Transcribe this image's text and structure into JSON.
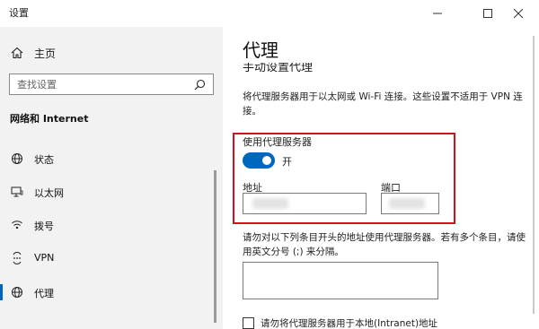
{
  "window": {
    "title": "设置",
    "minimize_icon": "minimize-icon",
    "maximize_icon": "maximize-icon",
    "close_icon": "close-icon"
  },
  "sidebar": {
    "home_label": "主页",
    "home_icon": "home-icon",
    "search_placeholder": "查找设置",
    "search_icon": "search-icon",
    "section_title": "网络和 Internet",
    "items": [
      {
        "label": "状态",
        "icon": "globe-icon",
        "active": false
      },
      {
        "label": "以太网",
        "icon": "monitor-icon",
        "active": false
      },
      {
        "label": "拨号",
        "icon": "dialup-icon",
        "active": false
      },
      {
        "label": "VPN",
        "icon": "vpn-icon",
        "active": false
      },
      {
        "label": "代理",
        "icon": "globe-proxy-icon",
        "active": true
      }
    ]
  },
  "main": {
    "page_title": "代理",
    "partial_heading": "手动设置代理",
    "description": "将代理服务器用于以太网或 Wi-Fi 连接。这些设置不适用于 VPN 连接。",
    "use_proxy_label": "使用代理服务器",
    "toggle_on": true,
    "toggle_state_label": "开",
    "address_label": "地址",
    "address_value": "",
    "port_label": "端口",
    "port_value": "",
    "exceptions_description": "请勿对以下列条目开头的地址使用代理服务器。若有多个条目，请使用英文分号 (;) 来分隔。",
    "exceptions_value": "",
    "local_bypass_checked": false,
    "local_bypass_label": "请勿将代理服务器用于本地(Intranet)地址"
  },
  "colors": {
    "accent": "#0067c0",
    "highlight_border": "#d2121f",
    "sidebar_bg": "#f2f2f2"
  }
}
